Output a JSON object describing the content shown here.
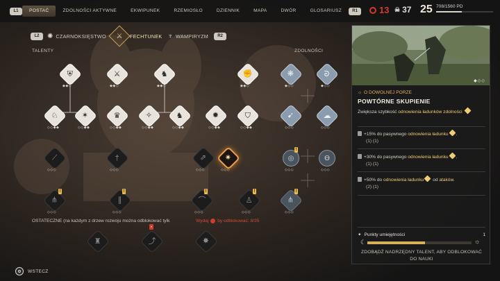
{
  "topbar": {
    "left_key": "L1",
    "right_key": "R1",
    "tabs": [
      "POSTAĆ",
      "ZDOLNOŚCI AKTYWNE",
      "EKWIPUNEK",
      "RZEMIOSŁO",
      "DZIENNIK",
      "MAPA",
      "DWÓR",
      "GLOSARIUSZ"
    ],
    "red_value": "13",
    "skull_value": "37",
    "level": "25",
    "xp_text": "708/1560 PD",
    "xp_fraction": 0.454
  },
  "tree_tabs": {
    "l_key": "L2",
    "r_key": "R2",
    "items": [
      {
        "label": "CZARNOKSIĘSTWO"
      },
      {
        "label": "FECHTUNEK"
      },
      {
        "label": "WAMPIRYZM"
      }
    ]
  },
  "sections": {
    "talents": "TALENTY",
    "abilities": "ZDOLNOŚCI"
  },
  "footer_tree": {
    "left_text": "OSTATECZNE (na każdym z drzew rozwoju można odblokować tylk",
    "cost_text": "Wydaj",
    "cost_suffix": "by odblokować: 8/35"
  },
  "panel": {
    "tag": "O DOWOLNEJ PORZE",
    "title": "POWTÓRNE SKUPIENIE",
    "desc_prefix": "Zwiększa szybkość ",
    "desc_highlight": "odnowienia ładunków zdolności",
    "levels": [
      {
        "pre": "+15% do pasywnego ",
        "hl": "odnowienia ładunku",
        "post": ".",
        "sub": "(1) (1)"
      },
      {
        "pre": "+30% do pasywnego ",
        "hl": "odnowienia ładunku",
        "post": ".",
        "sub": "(1) (1)"
      },
      {
        "pre": "+50% do ",
        "hl": "odnowienia ładunku",
        "mid": " od ",
        "hl2": "ataków",
        "post": ".",
        "sub": "(2) (1)"
      }
    ],
    "points_label": "Punkty umiejętności",
    "points_value": "1",
    "progress_fraction": 0.55,
    "unlock_message": "ZDOBĄDŹ NADRZĘDNY TALENT, ABY ODBLOKOWAĆ DO NAUKI"
  },
  "back_label": "WSTECZ",
  "colors": {
    "accent_gold": "#e3b15b",
    "selected_orange": "#e9a14a",
    "red": "#d23a2a"
  }
}
